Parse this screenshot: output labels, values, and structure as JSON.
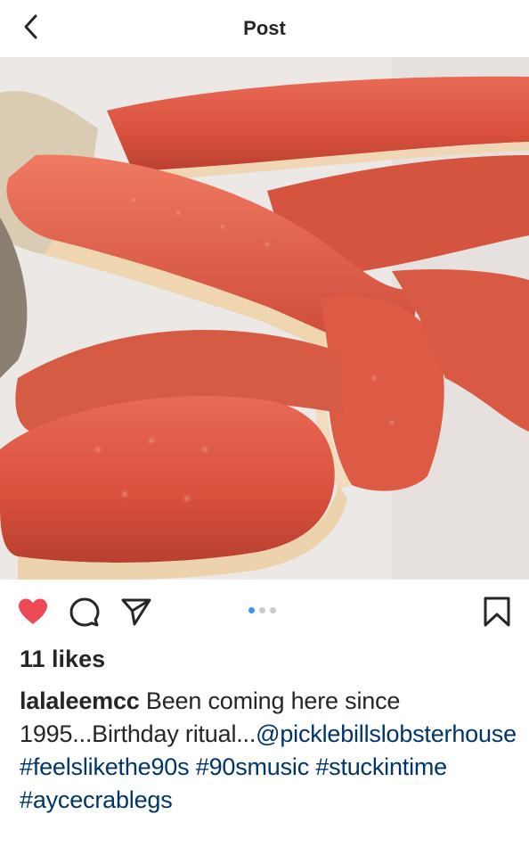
{
  "header": {
    "title": "Post",
    "back_icon": "chevron-left-icon"
  },
  "colors": {
    "heart": "#ed4956",
    "hashtag": "#003569",
    "dot_active": "#3897f0",
    "text": "#262626"
  },
  "actions": {
    "like_icon": "heart-filled-icon",
    "comment_icon": "comment-icon",
    "share_icon": "paper-plane-icon",
    "save_icon": "bookmark-icon",
    "carousel_pages": 3,
    "carousel_active": 1
  },
  "post": {
    "likes": "11 likes",
    "username": "lalaleemcc",
    "caption_text": "Been coming here since 1995...Birthday ritual...",
    "mention": "@picklebillslobsterhouse",
    "hashtags": [
      "#feelslikethe90s",
      "#90smusic",
      "#stuckintime",
      "#aycecrablegs"
    ]
  }
}
